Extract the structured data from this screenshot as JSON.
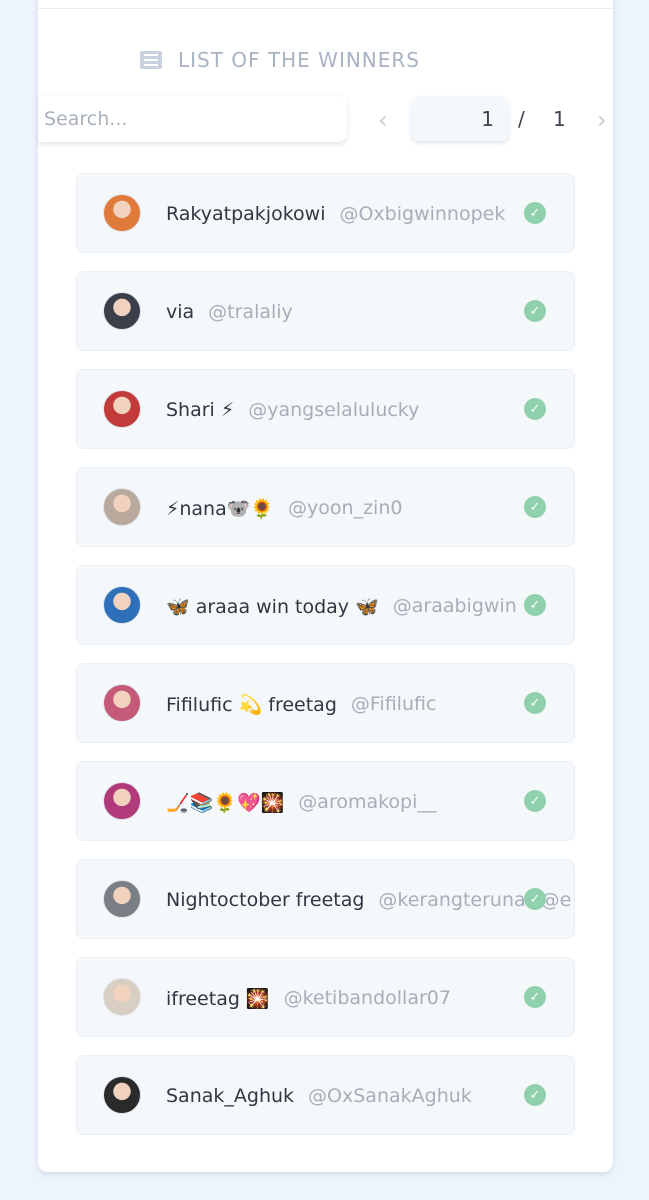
{
  "header": {
    "title": "LIST OF THE WINNERS",
    "icon": "list-icon"
  },
  "search": {
    "placeholder": "Search...",
    "value": ""
  },
  "pagination": {
    "current": "1",
    "separator": "/",
    "total": "1"
  },
  "colors": {
    "check": "#8fd1ac",
    "background": "#eef4fc",
    "card": "#ffffff"
  },
  "winners": [
    {
      "name": "Rakyatpakjokowi",
      "handle": "@Oxbigwinnopek",
      "avatar_color": "#e07a3a"
    },
    {
      "name": "via",
      "handle": "@tralaliy",
      "avatar_color": "#3b3f4a"
    },
    {
      "name": "Shari ⚡",
      "handle": "@yangselalulucky",
      "avatar_color": "#c23a3a"
    },
    {
      "name": "⚡nana🐨🌻",
      "handle": "@yoon_zin0",
      "avatar_color": "#b8a99c"
    },
    {
      "name": "🦋 araaa win today 🦋",
      "handle": "@araabigwin",
      "avatar_color": "#2d6fb8"
    },
    {
      "name": "Fifilufic 💫 freetag",
      "handle": "@Fifilufic",
      "avatar_color": "#c55a78"
    },
    {
      "name": "🏒📚🌻💖🎇",
      "handle": "@aromakopi__",
      "avatar_color": "#b03a7a"
    },
    {
      "name": "Nightoctober freetag",
      "handle": "@kerangterunaQ@e",
      "avatar_color": "#7a7f86"
    },
    {
      "name": "ifreetag 🎇",
      "handle": "@ketibandollar07",
      "avatar_color": "#d8cfc2"
    },
    {
      "name": "Sanak_Aghuk",
      "handle": "@OxSanakAghuk",
      "avatar_color": "#2a2a2a"
    }
  ]
}
